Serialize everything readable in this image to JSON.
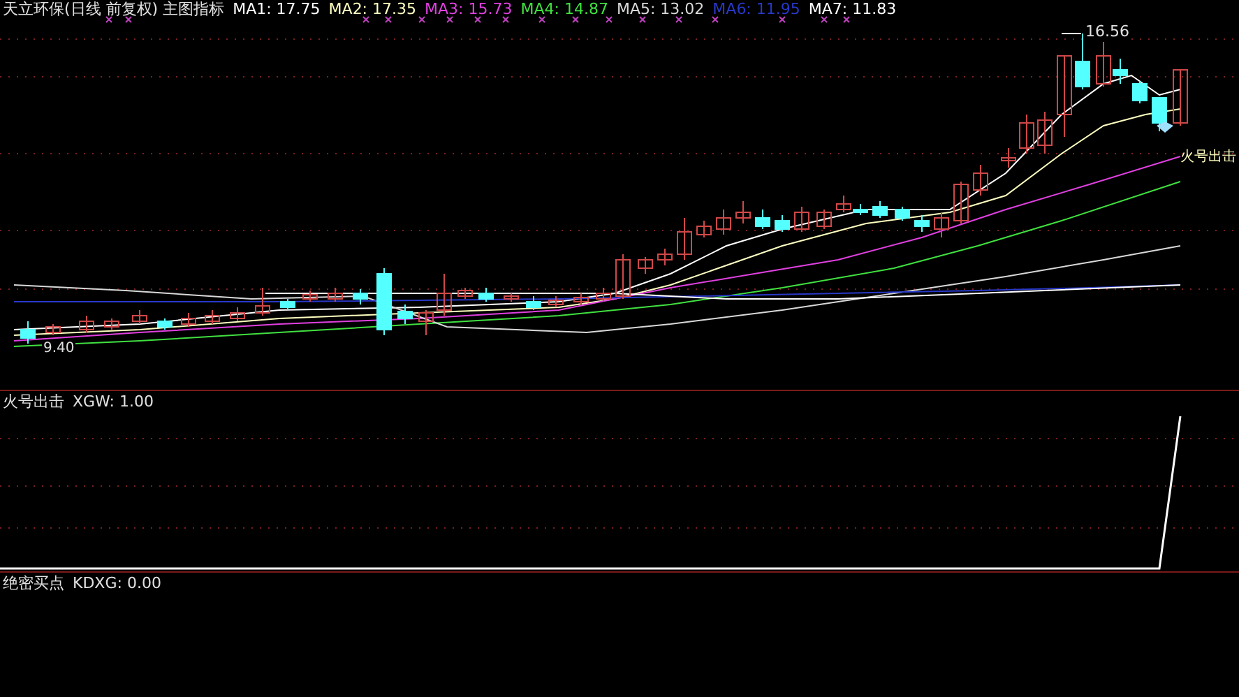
{
  "main_chart": {
    "title": "天立环保(日线 前复权) 主图指标",
    "ma_readings": [
      {
        "label": "MA1: 17.75",
        "color": "#ffffff"
      },
      {
        "label": "MA2: 17.35",
        "color": "#ffffc0"
      },
      {
        "label": "MA3: 15.73",
        "color": "#e040e0"
      },
      {
        "label": "MA4: 14.87",
        "color": "#40e040"
      },
      {
        "label": "MA5: 13.02",
        "color": "#d8d8d8"
      },
      {
        "label": "MA6: 11.95",
        "color": "#2838c8"
      },
      {
        "label": "MA7: 11.83",
        "color": "#ffffff"
      }
    ],
    "high_label": "16.56",
    "low_label": "9.40",
    "signal_label": "火号出击"
  },
  "indicator_panel": {
    "title": "火号出击",
    "reading": "XGW: 1.00"
  },
  "bottom_panel": {
    "title": "绝密买点",
    "reading": "KDXG: 0.00"
  }
}
